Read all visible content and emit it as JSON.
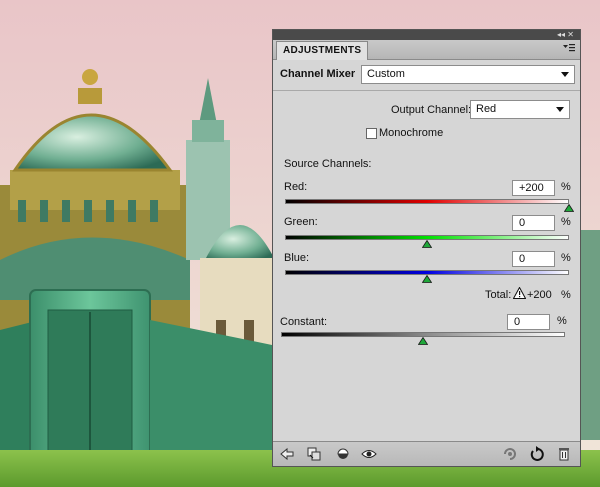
{
  "panel": {
    "tab_label": "ADJUSTMENTS",
    "title_controls": "◂◂ ✕",
    "menu_icon": "panel-menu-icon",
    "adjustment_name": "Channel Mixer",
    "preset_value": "Custom",
    "output_channel_label": "Output Channel:",
    "output_channel_value": "Red",
    "monochrome_label": "Monochrome",
    "monochrome_checked": false,
    "source_channels_label": "Source Channels:",
    "percent_sign": "%",
    "red": {
      "label": "Red:",
      "value": "+200",
      "level_percent": 200
    },
    "green": {
      "label": "Green:",
      "value": "0",
      "level_percent": 0
    },
    "blue": {
      "label": "Blue:",
      "value": "0",
      "level_percent": 0
    },
    "total": {
      "label": "Total:",
      "value": "+200"
    },
    "constant": {
      "label": "Constant:",
      "value": "0",
      "level_percent": 0
    },
    "bottom_icons": [
      "return-arrow-icon",
      "clip-to-layer-icon",
      "visibility-eye-icon",
      "eye-icon",
      "view-previous-state-icon",
      "reset-icon",
      "trash-icon"
    ],
    "colors": {
      "red_track": "#e00000",
      "green_track": "#00e000",
      "blue_track": "#0000e0",
      "thumb_fill": "#1fa83a"
    }
  }
}
